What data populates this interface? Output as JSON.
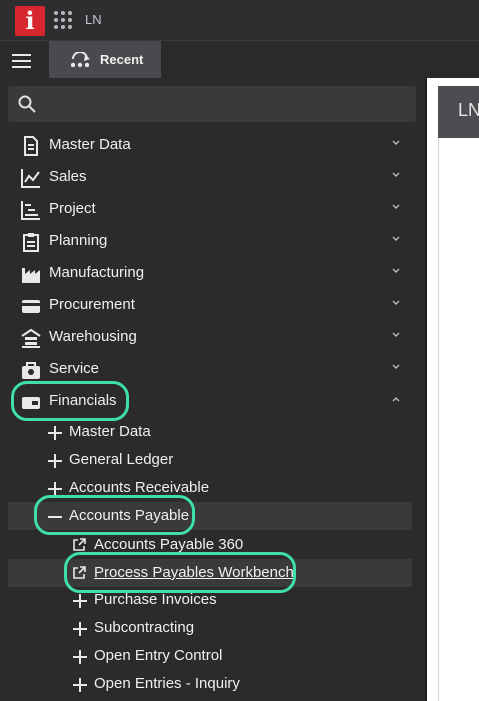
{
  "app": {
    "logo_letter": "i",
    "name": "LN"
  },
  "tabs": [
    {
      "label": "Recent"
    }
  ],
  "search": {
    "placeholder": ""
  },
  "menu": [
    {
      "label": "Master Data",
      "icon": "document-icon"
    },
    {
      "label": "Sales",
      "icon": "line-chart-icon"
    },
    {
      "label": "Project",
      "icon": "project-gantt-icon"
    },
    {
      "label": "Planning",
      "icon": "clipboard-icon"
    },
    {
      "label": "Manufacturing",
      "icon": "factory-icon"
    },
    {
      "label": "Procurement",
      "icon": "credit-card-icon"
    },
    {
      "label": "Warehousing",
      "icon": "warehouse-icon"
    },
    {
      "label": "Service",
      "icon": "service-bag-icon"
    },
    {
      "label": "Financials",
      "icon": "wallet-icon"
    }
  ],
  "financials_children": [
    {
      "label": "Master Data"
    },
    {
      "label": "General Ledger"
    },
    {
      "label": "Accounts Receivable"
    },
    {
      "label": "Accounts Payable"
    }
  ],
  "accounts_payable_children": [
    {
      "label": "Accounts Payable 360",
      "icon": "external-link-icon"
    },
    {
      "label": "Process Payables Workbench",
      "icon": "external-link-icon"
    },
    {
      "label": "Purchase Invoices"
    },
    {
      "label": "Subcontracting"
    },
    {
      "label": "Open Entry Control"
    },
    {
      "label": "Open Entries - Inquiry"
    }
  ],
  "content": {
    "header_text": "LN"
  },
  "colors": {
    "highlight": "#3fe0a6",
    "logo": "#d6262e"
  }
}
